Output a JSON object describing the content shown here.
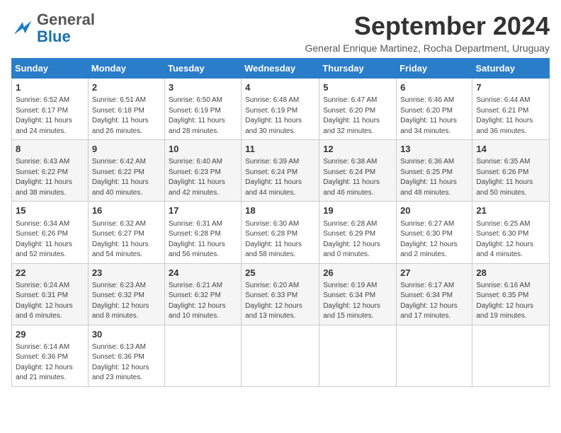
{
  "header": {
    "logo": {
      "general": "General",
      "blue": "Blue"
    },
    "title": "September 2024",
    "subtitle": "General Enrique Martinez, Rocha Department, Uruguay"
  },
  "weekdays": [
    "Sunday",
    "Monday",
    "Tuesday",
    "Wednesday",
    "Thursday",
    "Friday",
    "Saturday"
  ],
  "weeks": [
    [
      {
        "day": "1",
        "sunrise": "6:52 AM",
        "sunset": "6:17 PM",
        "daylight": "11 hours and 24 minutes."
      },
      {
        "day": "2",
        "sunrise": "6:51 AM",
        "sunset": "6:18 PM",
        "daylight": "11 hours and 26 minutes."
      },
      {
        "day": "3",
        "sunrise": "6:50 AM",
        "sunset": "6:19 PM",
        "daylight": "11 hours and 28 minutes."
      },
      {
        "day": "4",
        "sunrise": "6:48 AM",
        "sunset": "6:19 PM",
        "daylight": "11 hours and 30 minutes."
      },
      {
        "day": "5",
        "sunrise": "6:47 AM",
        "sunset": "6:20 PM",
        "daylight": "11 hours and 32 minutes."
      },
      {
        "day": "6",
        "sunrise": "6:46 AM",
        "sunset": "6:20 PM",
        "daylight": "11 hours and 34 minutes."
      },
      {
        "day": "7",
        "sunrise": "6:44 AM",
        "sunset": "6:21 PM",
        "daylight": "11 hours and 36 minutes."
      }
    ],
    [
      {
        "day": "8",
        "sunrise": "6:43 AM",
        "sunset": "6:22 PM",
        "daylight": "11 hours and 38 minutes."
      },
      {
        "day": "9",
        "sunrise": "6:42 AM",
        "sunset": "6:22 PM",
        "daylight": "11 hours and 40 minutes."
      },
      {
        "day": "10",
        "sunrise": "6:40 AM",
        "sunset": "6:23 PM",
        "daylight": "11 hours and 42 minutes."
      },
      {
        "day": "11",
        "sunrise": "6:39 AM",
        "sunset": "6:24 PM",
        "daylight": "11 hours and 44 minutes."
      },
      {
        "day": "12",
        "sunrise": "6:38 AM",
        "sunset": "6:24 PM",
        "daylight": "11 hours and 46 minutes."
      },
      {
        "day": "13",
        "sunrise": "6:36 AM",
        "sunset": "6:25 PM",
        "daylight": "11 hours and 48 minutes."
      },
      {
        "day": "14",
        "sunrise": "6:35 AM",
        "sunset": "6:26 PM",
        "daylight": "11 hours and 50 minutes."
      }
    ],
    [
      {
        "day": "15",
        "sunrise": "6:34 AM",
        "sunset": "6:26 PM",
        "daylight": "11 hours and 52 minutes."
      },
      {
        "day": "16",
        "sunrise": "6:32 AM",
        "sunset": "6:27 PM",
        "daylight": "11 hours and 54 minutes."
      },
      {
        "day": "17",
        "sunrise": "6:31 AM",
        "sunset": "6:28 PM",
        "daylight": "11 hours and 56 minutes."
      },
      {
        "day": "18",
        "sunrise": "6:30 AM",
        "sunset": "6:28 PM",
        "daylight": "11 hours and 58 minutes."
      },
      {
        "day": "19",
        "sunrise": "6:28 AM",
        "sunset": "6:29 PM",
        "daylight": "12 hours and 0 minutes."
      },
      {
        "day": "20",
        "sunrise": "6:27 AM",
        "sunset": "6:30 PM",
        "daylight": "12 hours and 2 minutes."
      },
      {
        "day": "21",
        "sunrise": "6:25 AM",
        "sunset": "6:30 PM",
        "daylight": "12 hours and 4 minutes."
      }
    ],
    [
      {
        "day": "22",
        "sunrise": "6:24 AM",
        "sunset": "6:31 PM",
        "daylight": "12 hours and 6 minutes."
      },
      {
        "day": "23",
        "sunrise": "6:23 AM",
        "sunset": "6:32 PM",
        "daylight": "12 hours and 8 minutes."
      },
      {
        "day": "24",
        "sunrise": "6:21 AM",
        "sunset": "6:32 PM",
        "daylight": "12 hours and 10 minutes."
      },
      {
        "day": "25",
        "sunrise": "6:20 AM",
        "sunset": "6:33 PM",
        "daylight": "12 hours and 13 minutes."
      },
      {
        "day": "26",
        "sunrise": "6:19 AM",
        "sunset": "6:34 PM",
        "daylight": "12 hours and 15 minutes."
      },
      {
        "day": "27",
        "sunrise": "6:17 AM",
        "sunset": "6:34 PM",
        "daylight": "12 hours and 17 minutes."
      },
      {
        "day": "28",
        "sunrise": "6:16 AM",
        "sunset": "6:35 PM",
        "daylight": "12 hours and 19 minutes."
      }
    ],
    [
      {
        "day": "29",
        "sunrise": "6:14 AM",
        "sunset": "6:36 PM",
        "daylight": "12 hours and 21 minutes."
      },
      {
        "day": "30",
        "sunrise": "6:13 AM",
        "sunset": "6:36 PM",
        "daylight": "12 hours and 23 minutes."
      },
      null,
      null,
      null,
      null,
      null
    ]
  ],
  "labels": {
    "sunrise": "Sunrise:",
    "sunset": "Sunset:",
    "daylight": "Daylight:"
  }
}
